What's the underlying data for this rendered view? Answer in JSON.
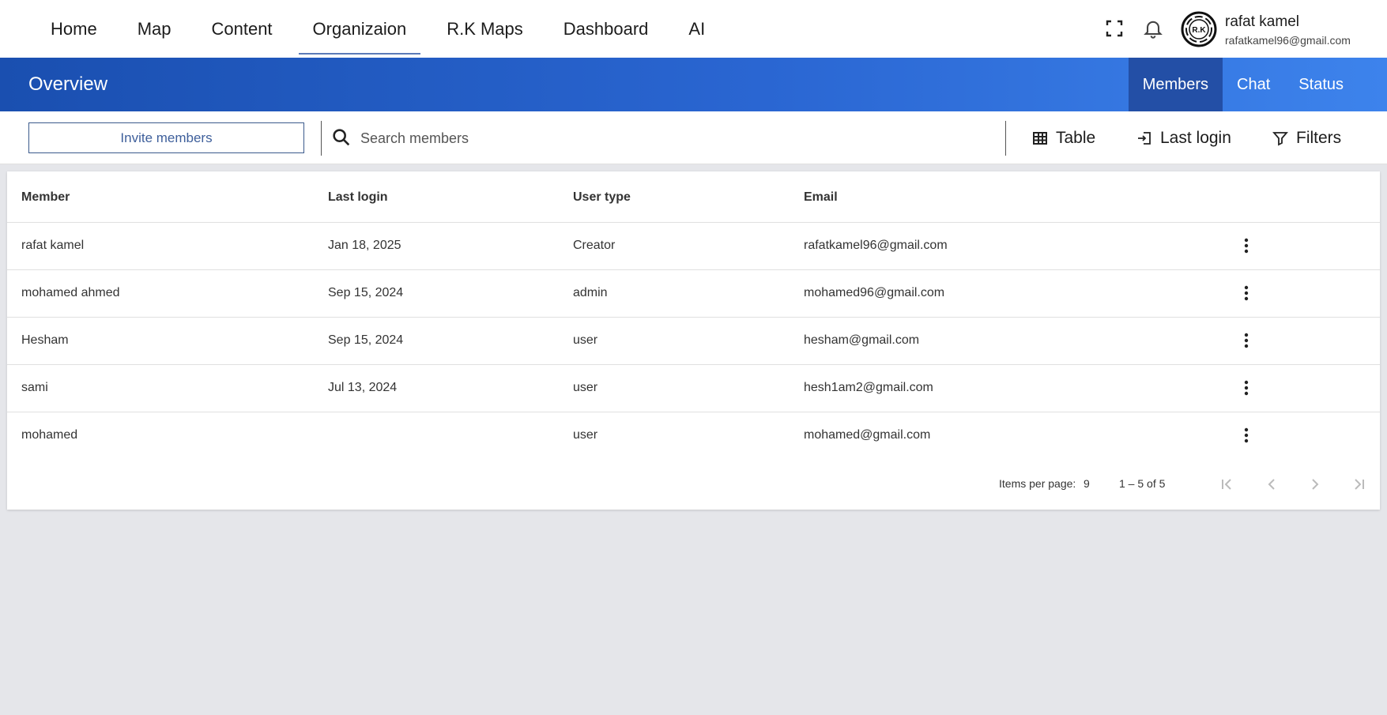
{
  "nav": {
    "items": [
      {
        "label": "Home"
      },
      {
        "label": "Map"
      },
      {
        "label": "Content"
      },
      {
        "label": "Organizaion",
        "active": true
      },
      {
        "label": "R.K Maps"
      },
      {
        "label": "Dashboard"
      },
      {
        "label": "AI"
      }
    ],
    "icons": [
      "fullscreen-icon",
      "bell-icon"
    ]
  },
  "user": {
    "name": "rafat kamel",
    "email": "rafatkamel96@gmail.com",
    "avatar_text": "R.K"
  },
  "header": {
    "title": "Overview",
    "tabs": [
      {
        "label": "Members",
        "active": true
      },
      {
        "label": "Chat"
      },
      {
        "label": "Status"
      }
    ]
  },
  "toolbar": {
    "invite_label": "Invite members",
    "search_placeholder": "Search members",
    "table_label": "Table",
    "last_login_label": "Last login",
    "filters_label": "Filters"
  },
  "table": {
    "columns": [
      "Member",
      "Last login",
      "User type",
      "Email"
    ],
    "rows": [
      {
        "member": "rafat kamel",
        "last_login": "Jan 18, 2025",
        "user_type": "Creator",
        "email": "rafatkamel96@gmail.com"
      },
      {
        "member": "mohamed ahmed",
        "last_login": "Sep 15, 2024",
        "user_type": "admin",
        "email": "mohamed96@gmail.com"
      },
      {
        "member": "Hesham",
        "last_login": "Sep 15, 2024",
        "user_type": "user",
        "email": "hesham@gmail.com"
      },
      {
        "member": "sami",
        "last_login": "Jul 13, 2024",
        "user_type": "user",
        "email": "hesh1am2@gmail.com"
      },
      {
        "member": "mohamed",
        "last_login": "",
        "user_type": "user",
        "email": "mohamed@gmail.com"
      }
    ]
  },
  "pagination": {
    "items_per_page_label": "Items per page:",
    "items_per_page": "9",
    "range": "1 – 5 of 5"
  },
  "colors": {
    "accent": "#1a4fb0",
    "accent_light": "#3d83ec",
    "active_tab": "#234fa6",
    "background": "#e5e6ea"
  }
}
